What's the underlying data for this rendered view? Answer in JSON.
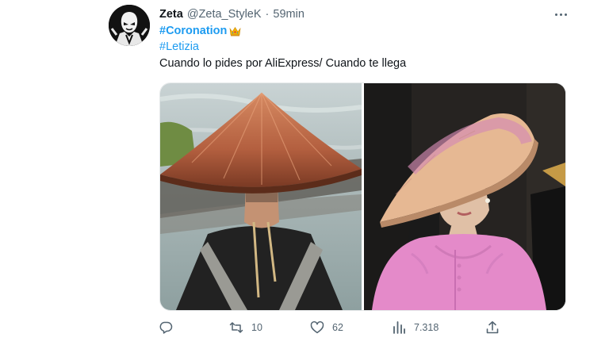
{
  "tweet": {
    "display_name": "Zeta",
    "handle": "@Zeta_StyleK",
    "separator": "·",
    "time": "59min",
    "hashtags": [
      "#Coronation",
      "#Letizia"
    ],
    "hashtag_emoji": "crown-emoji",
    "text": "Cuando lo pides por AliExpress/ Cuando te llega",
    "avatar_icon": "masked-figure-avatar",
    "media": [
      {
        "name": "man-in-conical-hat-photo"
      },
      {
        "name": "woman-in-pink-hat-photo"
      }
    ]
  },
  "actions": {
    "reply": {
      "icon": "reply-icon",
      "count": ""
    },
    "retweet": {
      "icon": "retweet-icon",
      "count": "10"
    },
    "like": {
      "icon": "heart-icon",
      "count": "62"
    },
    "views": {
      "icon": "views-icon",
      "count": "7.318"
    },
    "share": {
      "icon": "share-icon",
      "count": ""
    }
  },
  "colors": {
    "link": "#1d9bf0",
    "secondary_text": "#536471",
    "primary_text": "#0f1419"
  }
}
